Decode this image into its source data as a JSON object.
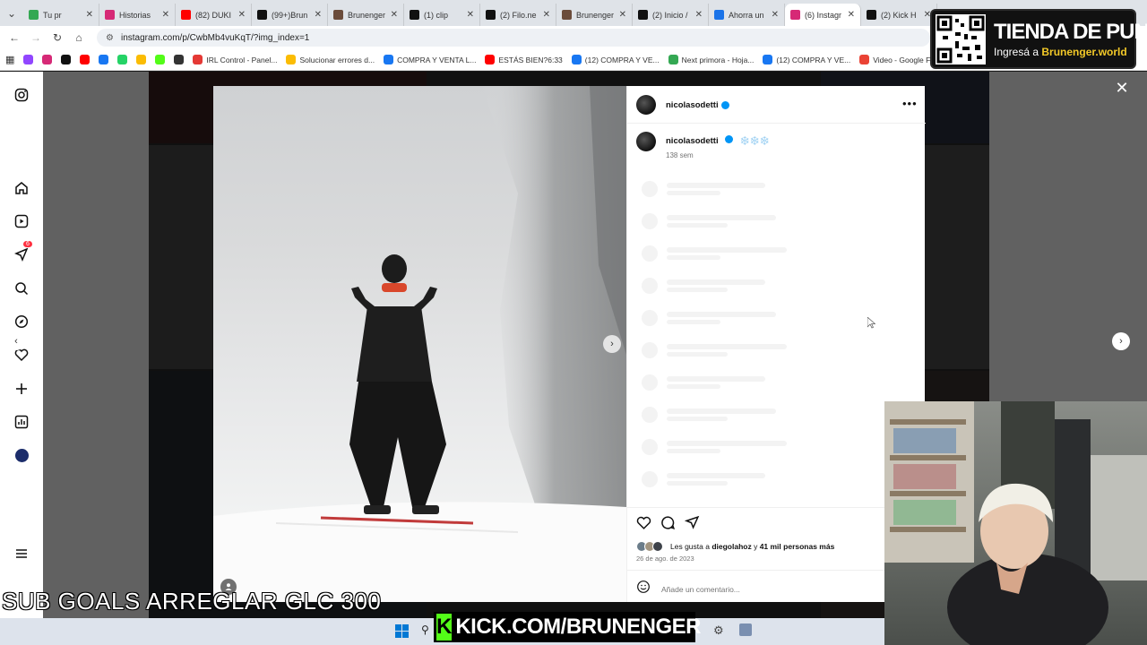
{
  "browser": {
    "tabs": [
      {
        "title": "Tu pr",
        "color": "#34a853"
      },
      {
        "title": "Historias",
        "color": "#d62976"
      },
      {
        "title": "(82) DUKI",
        "color": "#ff0000"
      },
      {
        "title": "(99+)Brun",
        "color": "#111111"
      },
      {
        "title": "Brunenger",
        "color": "#6b4c3b"
      },
      {
        "title": "(1) clip",
        "color": "#111111"
      },
      {
        "title": "(2) Filo.ne",
        "color": "#111111"
      },
      {
        "title": "Brunenger",
        "color": "#6b4c3b"
      },
      {
        "title": "(2) Inicio /",
        "color": "#111111"
      },
      {
        "title": "Ahorra un",
        "color": "#1a73e8"
      },
      {
        "title": "(6) Instagr",
        "color": "#d62976",
        "active": true
      },
      {
        "title": "(2) Kick H",
        "color": "#111111"
      }
    ],
    "url": "instagram.com/p/CwbMb4vuKqT/?img_index=1",
    "bookmarks": [
      {
        "label": "",
        "color": "#9146ff"
      },
      {
        "label": "",
        "color": "#d62976"
      },
      {
        "label": "",
        "color": "#111111"
      },
      {
        "label": "",
        "color": "#ff0000"
      },
      {
        "label": "",
        "color": "#1877f2"
      },
      {
        "label": "",
        "color": "#25d366"
      },
      {
        "label": "",
        "color": "#fbbc04"
      },
      {
        "label": "",
        "color": "#53fc18"
      },
      {
        "label": "",
        "color": "#333333"
      },
      {
        "label": "IRL Control - Panel...",
        "color": "#e53935"
      },
      {
        "label": "Solucionar errores d...",
        "color": "#fbbc04"
      },
      {
        "label": "COMPRA Y VENTA L...",
        "color": "#1877f2"
      },
      {
        "label": "ESTÁS BIEN?6:33",
        "color": "#ff0000"
      },
      {
        "label": "(12) COMPRA Y VE...",
        "color": "#1877f2"
      },
      {
        "label": "Next primora - Hoja...",
        "color": "#34a853"
      },
      {
        "label": "(12) COMPRA Y VE...",
        "color": "#1877f2"
      },
      {
        "label": "Video - Google Foto",
        "color": "#ea4335"
      }
    ]
  },
  "sidebar": {
    "items": [
      {
        "icon": "instagram-logo-icon"
      },
      {
        "icon": "home-icon"
      },
      {
        "icon": "reels-icon"
      },
      {
        "icon": "messages-icon",
        "badge": "6"
      },
      {
        "icon": "search-icon"
      },
      {
        "icon": "explore-icon"
      },
      {
        "icon": "notifications-icon"
      },
      {
        "icon": "create-icon"
      },
      {
        "icon": "dashboard-icon"
      },
      {
        "icon": "profile-icon"
      },
      {
        "icon": "menu-icon"
      }
    ]
  },
  "post": {
    "username": "nicolasodetti",
    "caption": "❄️❄️❄️",
    "time_ago": "138 sem",
    "likes_prefix": "Les gusta a ",
    "likes_user": "diegolahoz",
    "likes_mid": " y ",
    "likes_rest": "41 mil personas más",
    "date": "26 de ago. de 2023",
    "comment_placeholder": "Añade un comentario...",
    "accent": "#0095f6"
  },
  "overlays": {
    "promo_title": "TIENDA DE PUNTOS",
    "promo_sub_prefix": "Ingresá a ",
    "promo_sub_site": "Brunenger.world",
    "sub_goals": "SUB GOALS ARREGLAR GLC  300",
    "kick_text": "KICK.COM/BRUNENGER",
    "kick_logo": "K",
    "kick_color": "#53fc18"
  }
}
